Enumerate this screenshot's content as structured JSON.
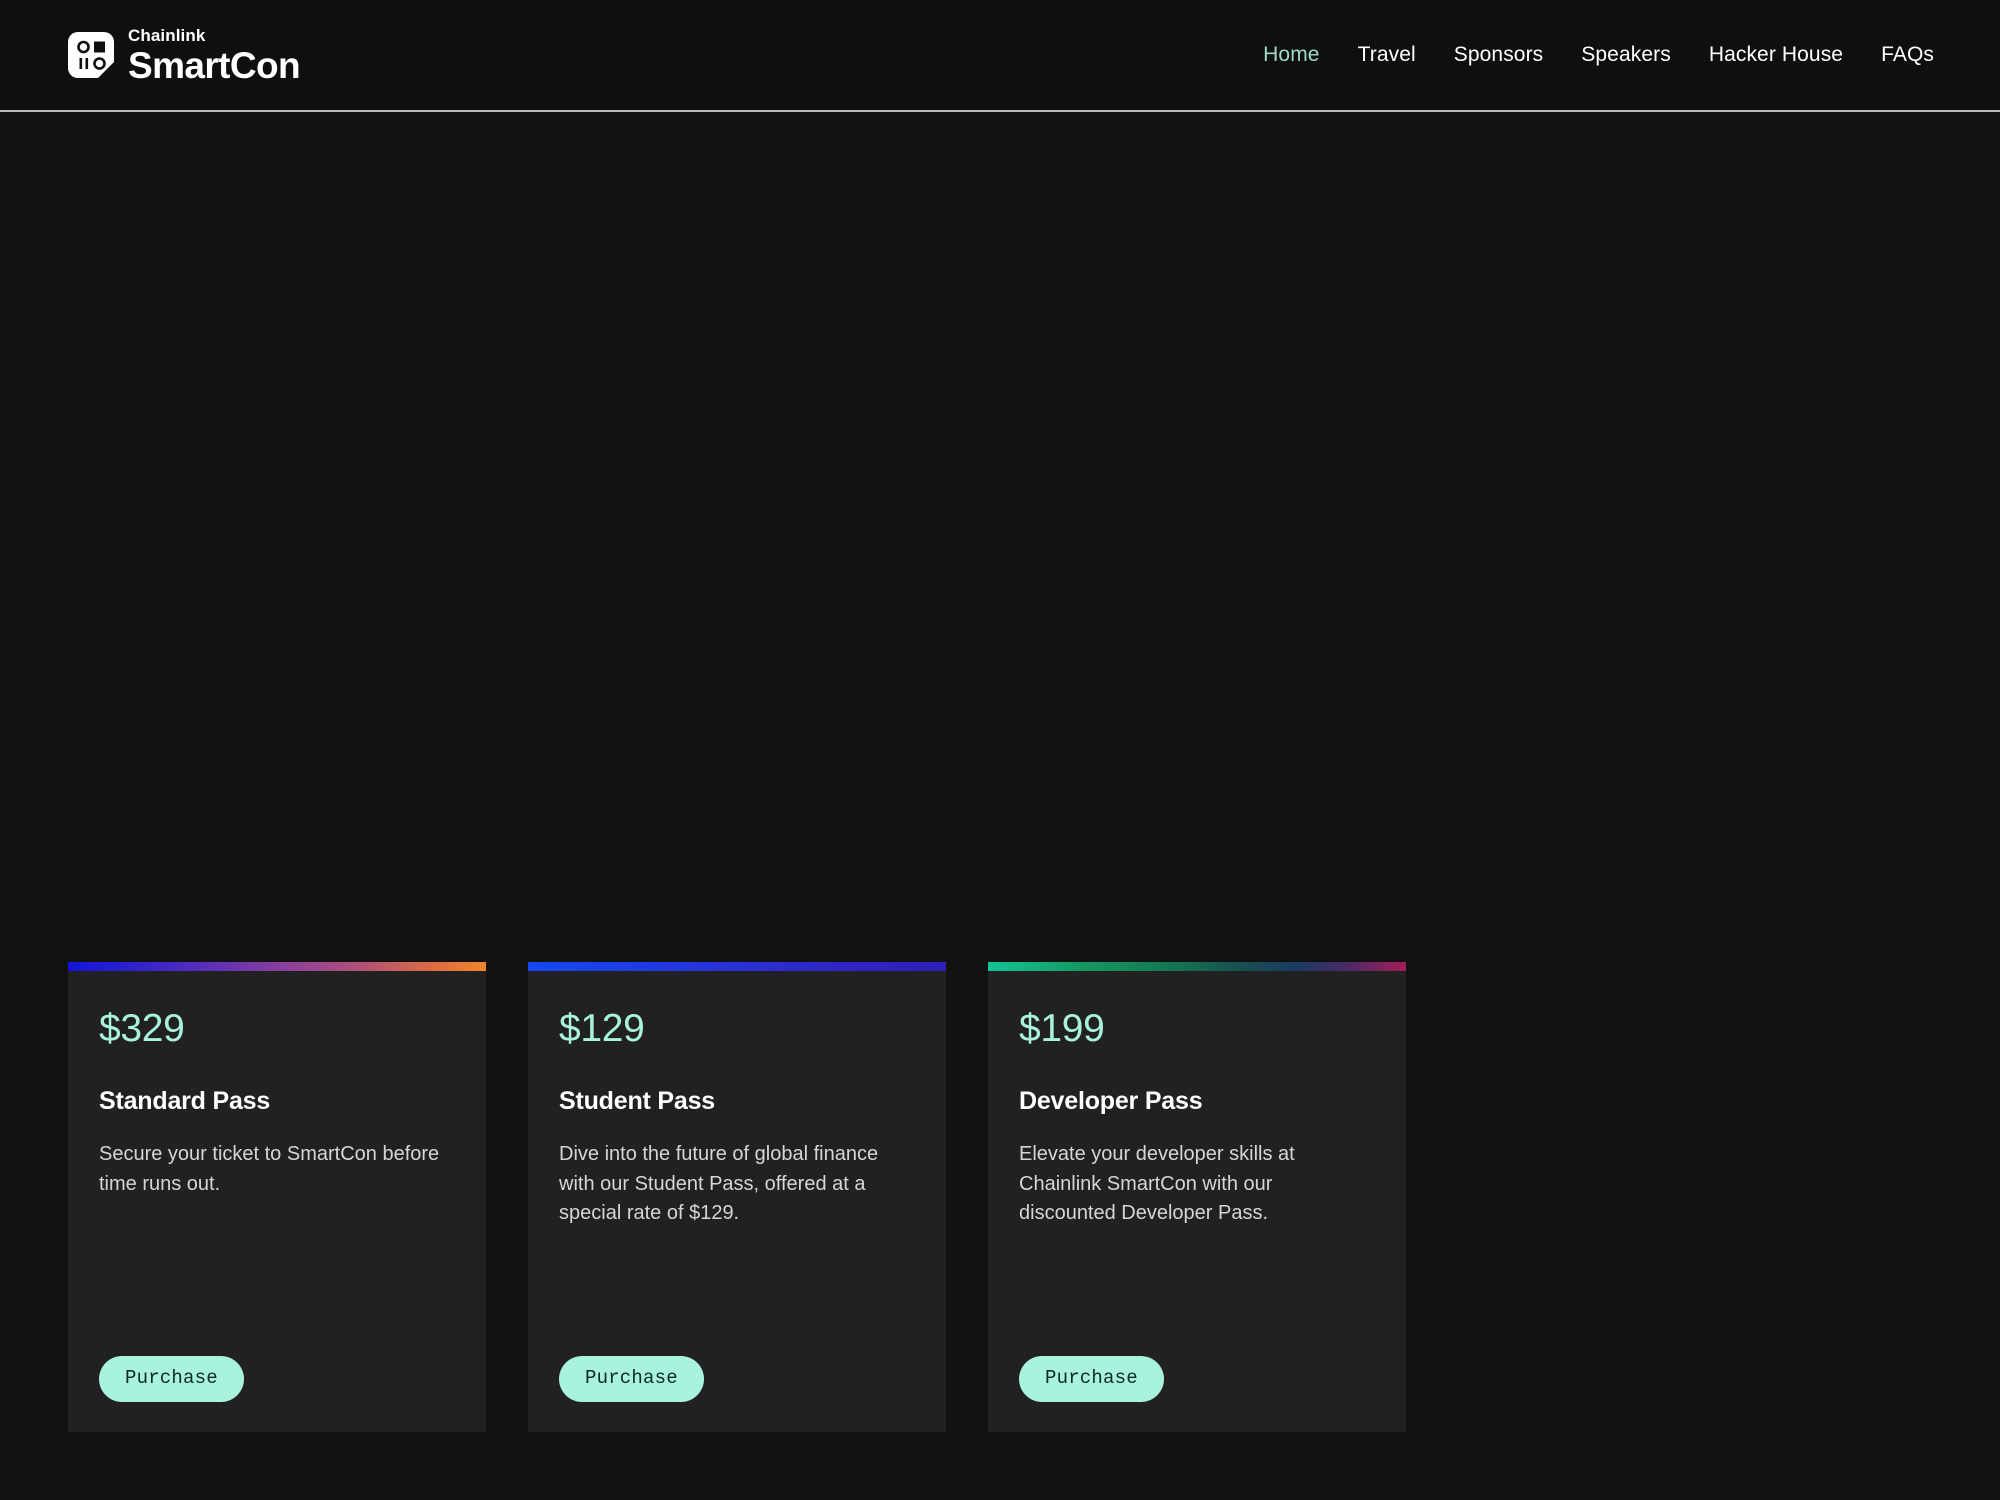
{
  "header": {
    "brand": {
      "logo_icon": "chainlink-cube-logo",
      "top_line": "Chainlink",
      "bottom_line": "SmartCon"
    },
    "nav": [
      {
        "label": "Home",
        "active": true
      },
      {
        "label": "Travel",
        "active": false
      },
      {
        "label": "Sponsors",
        "active": false
      },
      {
        "label": "Speakers",
        "active": false
      },
      {
        "label": "Hacker House",
        "active": false
      },
      {
        "label": "FAQs",
        "active": false
      }
    ]
  },
  "pricing": {
    "cards": [
      {
        "price": "$329",
        "title": "Standard Pass",
        "description": "Secure your ticket to SmartCon before time runs out.",
        "cta_label": "Purchase",
        "accent_gradient": "linear-gradient(90deg, #1414d8 0%, #2a20cf 14%, #5c2fb8 34%, #8c3f9c 52%, #b05177 70%, #d96a45 86%, #f0872a 100%)"
      },
      {
        "price": "$129",
        "title": "Student Pass",
        "description": "Dive into the future of global finance with our Student Pass, offered at a special rate of $129.",
        "cta_label": "Purchase",
        "accent_gradient": "linear-gradient(90deg, #1548f2 0%, #1c3ee8 22%, #2a2fd4 52%, #2f23c2 78%, #2f1fb8 100%)"
      },
      {
        "price": "$199",
        "title": "Developer Pass",
        "description": "Elevate your developer skills at Chainlink SmartCon with our discounted Developer Pass.",
        "cta_label": "Purchase",
        "accent_gradient": "linear-gradient(90deg, #12c496 0%, #139a63 22%, #147a52 42%, #17504f 60%, #1b3a62 74%, #4a2a66 86%, #a41d55 100%)"
      }
    ]
  },
  "colors": {
    "page_background": "#111111",
    "header_background": "#0f0f0f",
    "header_border": "#b9b9b9",
    "card_background": "#212121",
    "accent_mint": "#a9f2dd",
    "nav_active": "#9fdac7",
    "text_primary": "#ffffff",
    "text_secondary": "#d6d6d6",
    "button_text": "#0c2a24"
  }
}
